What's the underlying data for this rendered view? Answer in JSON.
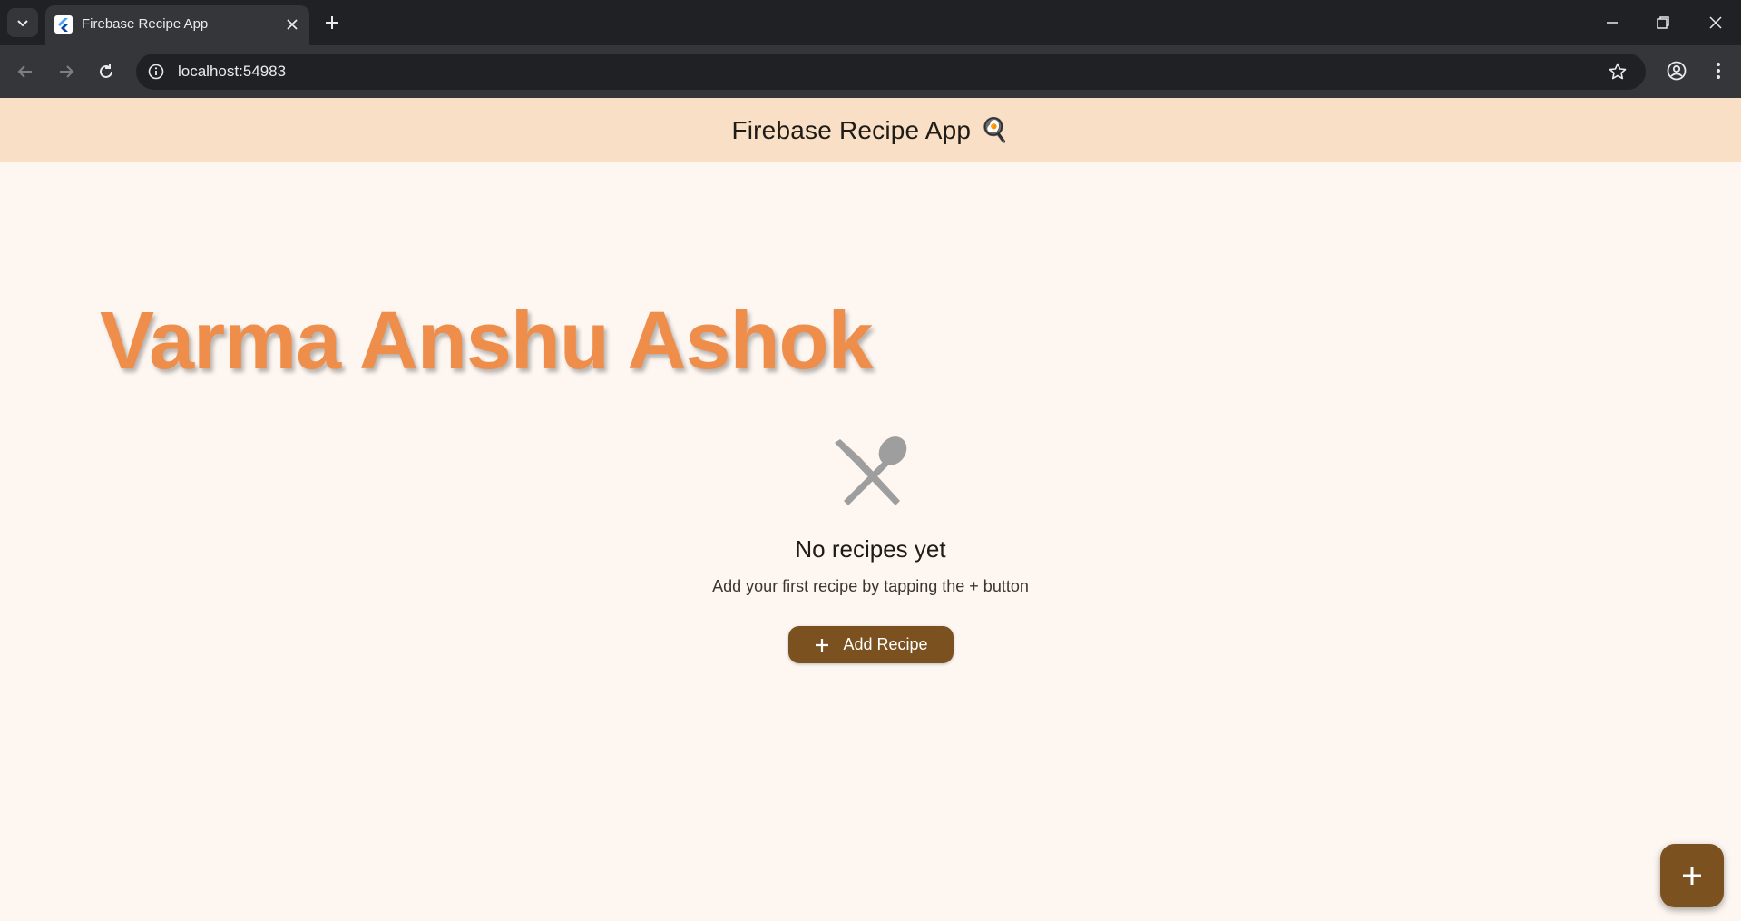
{
  "browser": {
    "tab_title": "Firebase Recipe App",
    "url": "localhost:54983"
  },
  "app": {
    "title": "Firebase Recipe App",
    "title_emoji": "🍳",
    "owner_name": "Varma Anshu Ashok",
    "empty_state": {
      "icon": "utensils-crossed-icon",
      "title": "No recipes yet",
      "subtitle": "Add your first recipe by tapping the + button",
      "button_label": "Add Recipe"
    },
    "fab_icon": "plus-icon"
  },
  "colors": {
    "appbar_bg": "#f8dfc5",
    "page_bg": "#fdf6f1",
    "accent_orange": "#ee8e4a",
    "button_brown": "#7b5120"
  }
}
